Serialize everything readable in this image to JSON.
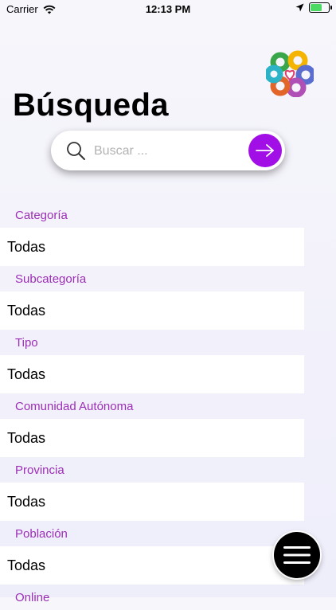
{
  "status_bar": {
    "carrier": "Carrier",
    "time": "12:13 PM",
    "battery_level": 0.7
  },
  "icons": {
    "wifi": "wifi-icon",
    "location": "location-arrow-icon",
    "battery": "battery-icon",
    "search": "magnifier-icon",
    "submit": "arrow-right-icon",
    "menu": "hamburger-menu-icon",
    "logo": "flower-heart-logo"
  },
  "colors": {
    "accent": "#a10ee6",
    "label": "#9b2fb5",
    "battery": "#4cd964"
  },
  "page": {
    "title": "Búsqueda"
  },
  "search": {
    "placeholder": "Buscar ...",
    "value": ""
  },
  "filters": [
    {
      "label": "Categoría",
      "value": "Todas"
    },
    {
      "label": "Subcategoría",
      "value": "Todas"
    },
    {
      "label": "Tipo",
      "value": "Todas"
    },
    {
      "label": "Comunidad Autónoma",
      "value": "Todas"
    },
    {
      "label": "Provincia",
      "value": "Todas"
    },
    {
      "label": "Población",
      "value": "Todas"
    },
    {
      "label": "Online",
      "value": ""
    }
  ]
}
